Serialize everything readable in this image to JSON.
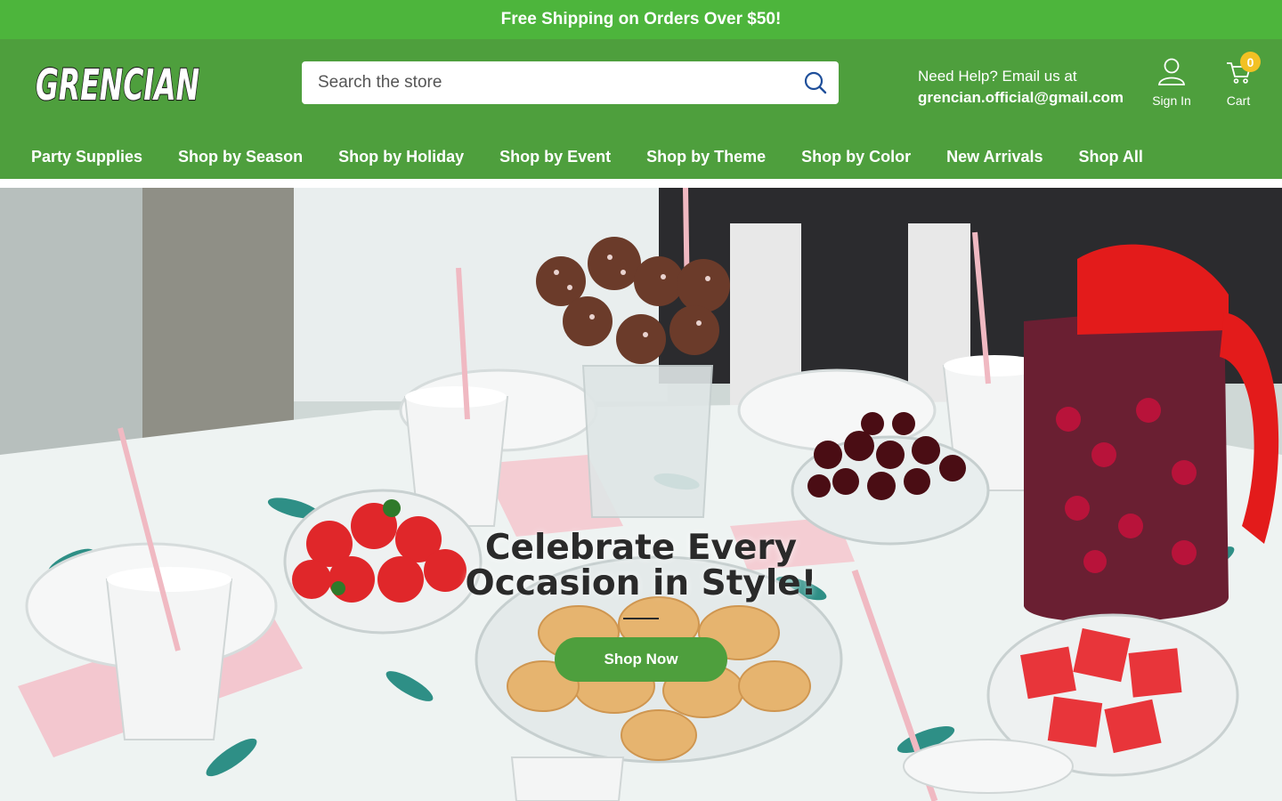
{
  "announcement": {
    "text": "Free Shipping on Orders Over $50!"
  },
  "brand": {
    "logo_text": "GRENCIAN"
  },
  "search": {
    "placeholder": "Search the store"
  },
  "help": {
    "label": "Need Help? Email us at",
    "email": "grencian.official@gmail.com"
  },
  "account": {
    "signin_label": "Sign In"
  },
  "cart": {
    "label": "Cart",
    "count": "0"
  },
  "nav": {
    "items": [
      {
        "label": "Party Supplies"
      },
      {
        "label": "Shop by Season"
      },
      {
        "label": "Shop by Holiday"
      },
      {
        "label": "Shop by Event"
      },
      {
        "label": "Shop by Theme"
      },
      {
        "label": "Shop by Color"
      },
      {
        "label": "New Arrivals"
      },
      {
        "label": "Shop All"
      }
    ]
  },
  "hero": {
    "title": "Celebrate Every Occasion in Style!",
    "cta_label": "Shop Now"
  },
  "colors": {
    "announcement_bg": "#4db53c",
    "header_bg": "#4e9f3d",
    "badge": "#f2c124",
    "cta_bg": "#4e9f3d"
  }
}
